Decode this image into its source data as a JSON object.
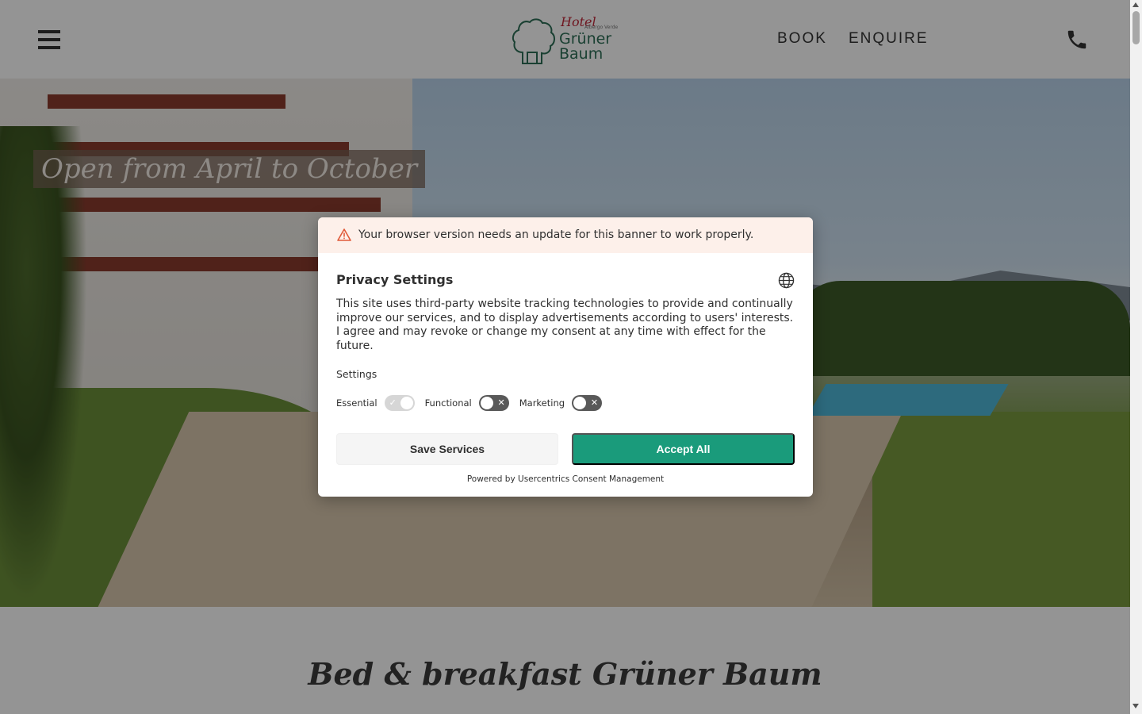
{
  "header": {
    "menu_icon": "hamburger-icon",
    "logo": {
      "hotel": "Hotel",
      "albergo": "Albergo Verde",
      "name_line1": "Grüner",
      "name_line2": "Baum"
    },
    "nav": {
      "book": "BOOK",
      "enquire": "ENQUIRE"
    },
    "phone_icon": "phone-icon"
  },
  "hero": {
    "open_label": "Open from April to October"
  },
  "section": {
    "title": "Bed & breakfast Grüner Baum"
  },
  "consent": {
    "warning": "Your browser version needs an update for this banner to work properly.",
    "title": "Privacy Settings",
    "description": "This site uses third-party website tracking technologies to provide and continually improve our services, and to display advertisements according to users' interests. I agree and may revoke or change my consent at any time with effect for the future.",
    "settings_label": "Settings",
    "toggles": [
      {
        "label": "Essential",
        "state": "on-disabled"
      },
      {
        "label": "Functional",
        "state": "off"
      },
      {
        "label": "Marketing",
        "state": "off"
      }
    ],
    "save_label": "Save Services",
    "accept_label": "Accept All",
    "powered_by": "Powered by Usercentrics Consent Management"
  },
  "colors": {
    "accent": "#1a9b7b",
    "brand_green": "#2d6f57",
    "brand_red": "#c0283a",
    "warning_bg": "#fdf0ea",
    "warning_icon": "#e05a3a"
  }
}
